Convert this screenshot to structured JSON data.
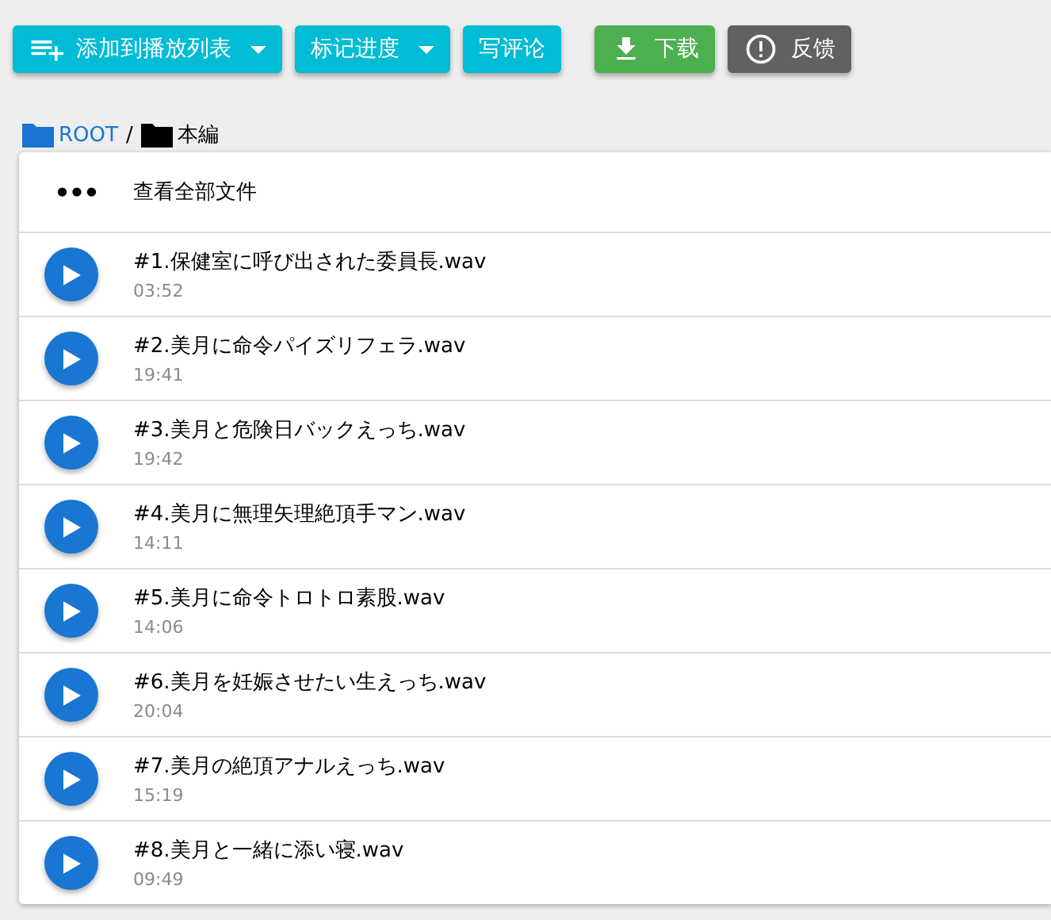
{
  "toolbar": [
    {
      "label": "添加到播放列表",
      "kind": "primary",
      "dropdown": true
    },
    {
      "label": "标记进度",
      "kind": "primary",
      "dropdown": true
    },
    {
      "label": "写评论",
      "kind": "primary",
      "dropdown": false
    },
    {
      "label": "下载",
      "kind": "success",
      "dropdown": false
    },
    {
      "label": "反馈",
      "kind": "dark",
      "dropdown": false
    }
  ],
  "breadcrumb": {
    "separator": "/",
    "items": [
      {
        "label": "ROOT",
        "link": true
      },
      {
        "label": "本編",
        "link": false
      }
    ]
  },
  "file_list": {
    "header": {
      "icon": "•••",
      "label": "查看全部文件"
    },
    "files": [
      {
        "name": "#1.保健室に呼び出された委員長.wav",
        "duration": "03:52"
      },
      {
        "name": "#2.美月に命令パイズリフェラ.wav",
        "duration": "19:41"
      },
      {
        "name": "#3.美月と危険日バックえっち.wav",
        "duration": "19:42"
      },
      {
        "name": "#4.美月に無理矢理絶頂手マン.wav",
        "duration": "14:11"
      },
      {
        "name": "#5.美月に命令トロトロ素股.wav",
        "duration": "14:06"
      },
      {
        "name": "#6.美月を妊娠させたい生えっち.wav",
        "duration": "20:04"
      },
      {
        "name": "#7.美月の絶頂アナルえっち.wav",
        "duration": "15:19"
      },
      {
        "name": "#8.美月と一緒に添い寝.wav",
        "duration": "09:49"
      }
    ]
  }
}
